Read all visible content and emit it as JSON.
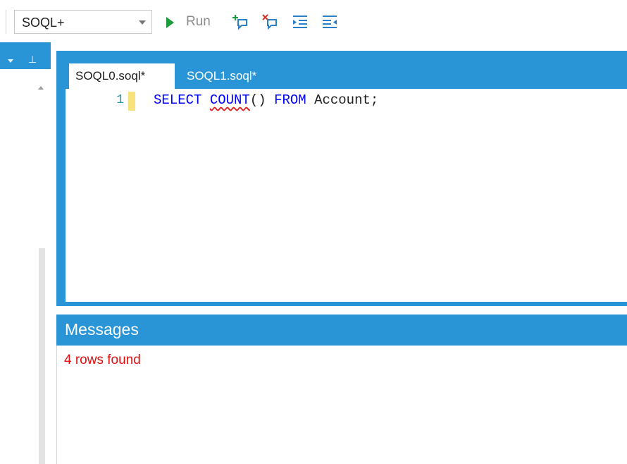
{
  "toolbar": {
    "language_select_value": "SOQL+",
    "run_label": "Run",
    "icons": [
      "play-icon",
      "add-breakpoint-icon",
      "remove-breakpoint-icon",
      "indent-icon",
      "outdent-icon"
    ],
    "colors": {
      "run_arrow": "#1c9c3c",
      "icon_blue": "#2a7fc6",
      "icon_red": "#d9302a"
    }
  },
  "left_dock": {
    "icons": [
      "dropdown-icon",
      "pin-icon",
      "scroll-up-icon"
    ]
  },
  "editor": {
    "tabs": [
      {
        "label": "SOQL0.soql*",
        "active": true
      },
      {
        "label": "SOQL1.soql*",
        "active": false
      }
    ],
    "line_number": "1",
    "code_tokens": {
      "kw_select": "SELECT",
      "fn_count": "COUNT",
      "parens": "()",
      "kw_from": "FROM",
      "rest": "Account;"
    },
    "colors": {
      "keyword": "#0000ff",
      "line_number": "#2b91af",
      "change_marker": "#f7e27c"
    }
  },
  "messages": {
    "title": "Messages",
    "text": "4 rows found",
    "colors": {
      "header": "#2a95d6",
      "text": "#e01010"
    }
  }
}
